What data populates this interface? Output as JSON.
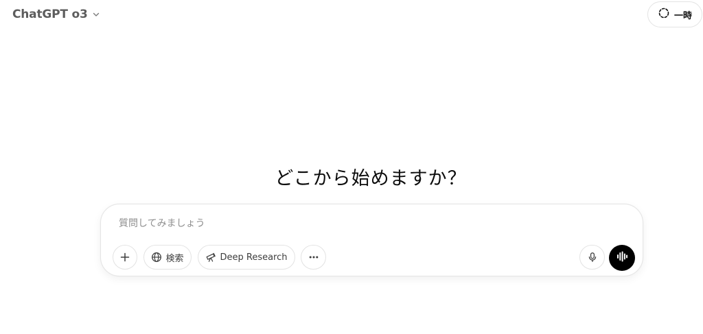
{
  "header": {
    "model_name": "ChatGPT o3",
    "model_chevron_icon": "chevron-down-icon",
    "temporary_chat": {
      "label": "一時",
      "icon": "dashed-circle-icon"
    }
  },
  "main": {
    "headline": "どこから始めますか？"
  },
  "composer": {
    "placeholder": "質問してみましょう",
    "value": "",
    "tools": {
      "add": {
        "icon": "plus-icon"
      },
      "search": {
        "label": "検索",
        "icon": "globe-icon"
      },
      "deep_research": {
        "label": "Deep Research",
        "icon": "telescope-icon"
      },
      "more": {
        "icon": "ellipsis-icon"
      }
    },
    "dictate": {
      "icon": "microphone-icon"
    },
    "voice_mode": {
      "icon": "voice-waveform-icon"
    }
  },
  "colors": {
    "background": "#ffffff",
    "text_primary": "#0d0d0d",
    "text_muted": "#5d5d5d",
    "placeholder": "#8f8f8f",
    "border": "#e3e3e3",
    "voice_button": "#000000"
  }
}
